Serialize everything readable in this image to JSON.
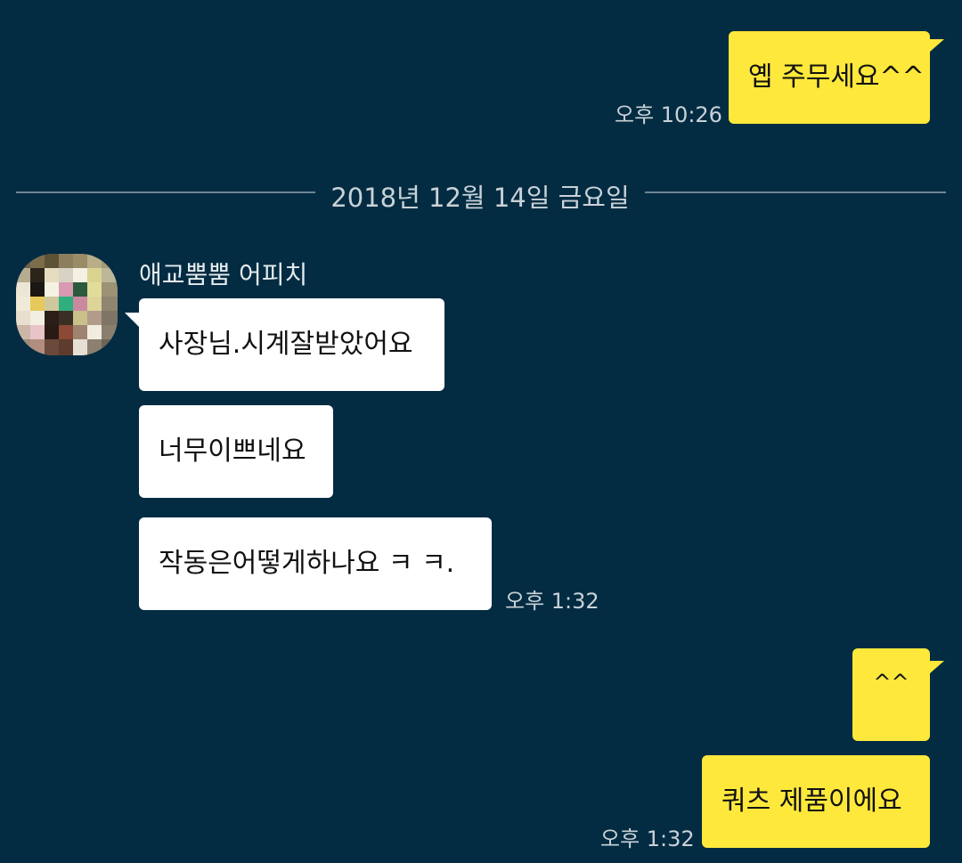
{
  "messages_top": {
    "sent_1": {
      "text": "옙 주무세요^^",
      "time": "오후 10:26"
    }
  },
  "date_divider": "2018년 12월 14일 금요일",
  "incoming": {
    "sender_name": "애교뿜뿜 어피치",
    "messages": [
      "사장님.시계잘받았어요",
      "너무이쁘네요",
      "작동은어떻게하나요 ㅋ ㅋ."
    ],
    "time": "오후 1:32"
  },
  "outgoing": {
    "messages": [
      "^^",
      "쿼츠 제품이에요"
    ],
    "time": "오후 1:32"
  },
  "colors": {
    "background": "#032c42",
    "sent_bubble": "#fde83b",
    "received_bubble": "#ffffff"
  }
}
